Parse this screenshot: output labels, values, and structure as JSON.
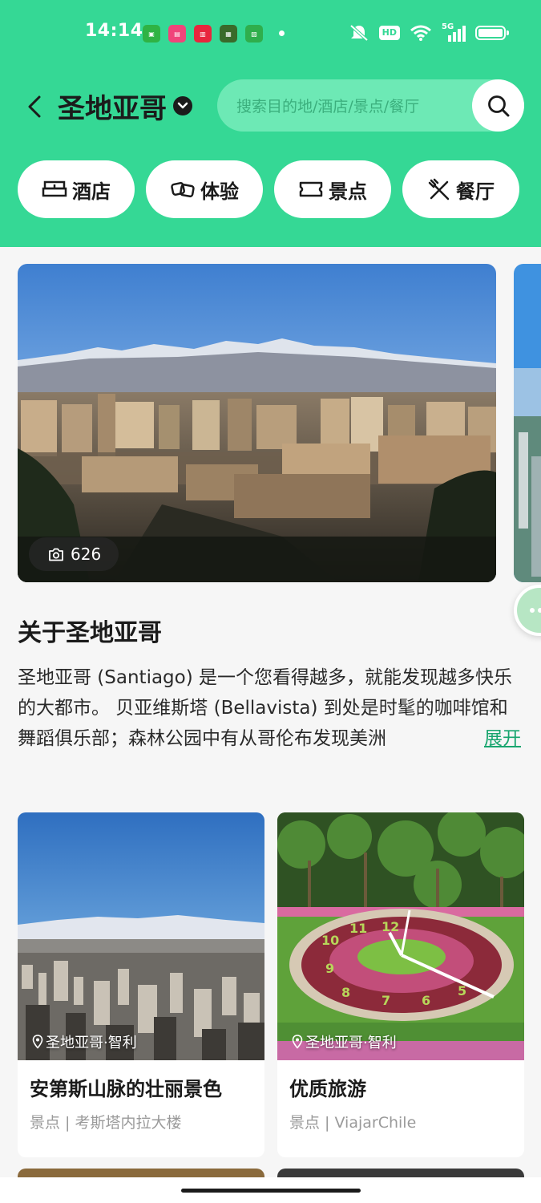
{
  "status_bar": {
    "time": "14:14",
    "hd": "HD",
    "network": "5G"
  },
  "header": {
    "city": "圣地亚哥",
    "search_placeholder": "搜索目的地/酒店/景点/餐厅",
    "icons": {
      "back": "chevron-left-icon",
      "dropdown": "chevron-down-icon",
      "search": "search-icon"
    }
  },
  "categories": [
    {
      "label": "酒店",
      "icon": "bed-icon"
    },
    {
      "label": "体验",
      "icon": "experience-icon"
    },
    {
      "label": "景点",
      "icon": "ticket-icon"
    },
    {
      "label": "餐厅",
      "icon": "fork-knife-icon"
    }
  ],
  "hero": {
    "photo_count": "626"
  },
  "about": {
    "title": "关于圣地亚哥",
    "text": "圣地亚哥 (Santiago) 是一个您看得越多，就能发现越多快乐的大都市。 贝亚维斯塔 (Bellavista) 到处是时髦的咖啡馆和舞蹈俱乐部；森林公园中有从哥伦布发现美洲",
    "expand": "展开"
  },
  "cards": [
    {
      "location": "圣地亚哥·智利",
      "title": "安第斯山脉的壮丽景色",
      "subtitle": "景点 | 考斯塔内拉大楼"
    },
    {
      "location": "圣地亚哥·智利",
      "title": "优质旅游",
      "subtitle": "景点 | ViajarChile"
    }
  ],
  "colors": {
    "brand_green": "#35d895",
    "link_green": "#18a56e",
    "search_bg": "#6de9b5"
  }
}
